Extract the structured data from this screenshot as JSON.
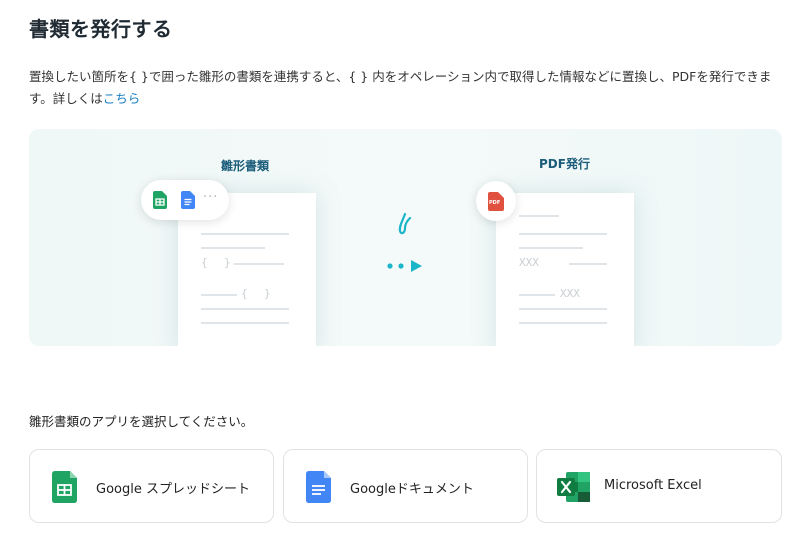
{
  "page": {
    "title": "書類を発行する",
    "description": "置換したい箇所を{ }で囲った雛形の書類を連携すると、{ } 内をオペレーション内で取得した情報などに置換し、PDFを発行できます。詳しくは",
    "link_text": "こちら"
  },
  "banner": {
    "template_label": "雛形書類",
    "pdf_label": "PDF発行",
    "more_glyph": "···",
    "brace_left_1": "{",
    "brace_right_1": "}",
    "brace_left_2": "{",
    "brace_right_2": "}",
    "placeholder_1": "XXX",
    "placeholder_2": "XXX",
    "pdf_badge": "PDF"
  },
  "apps": {
    "prompt": "雛形書類のアプリを選択してください。",
    "items": [
      {
        "label": "Google スプレッドシート",
        "icon": "google-sheets-icon"
      },
      {
        "label": "Googleドキュメント",
        "icon": "google-docs-icon"
      },
      {
        "label": "Microsoft Excel",
        "icon": "microsoft-excel-icon"
      }
    ]
  },
  "colors": {
    "sheets": "#1fa463",
    "docs": "#4285f4",
    "excel": "#1d6f42",
    "pdf": "#e0523f",
    "accent": "#1cb5c9",
    "link": "#1a7fc1"
  }
}
